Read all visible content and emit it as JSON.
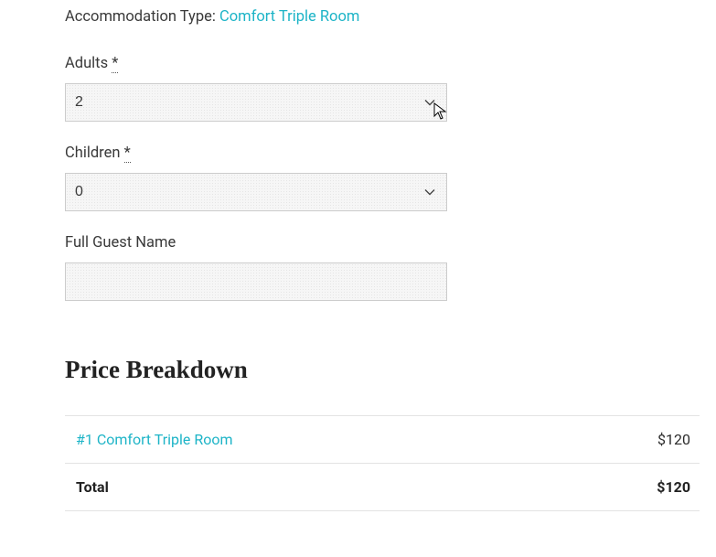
{
  "accommodation": {
    "label": "Accommodation Type:",
    "name": "Comfort Triple Room"
  },
  "fields": {
    "adults": {
      "label": "Adults",
      "required_marker": "*",
      "value": "2"
    },
    "children": {
      "label": "Children",
      "required_marker": "*",
      "value": "0"
    },
    "full_guest_name": {
      "label": "Full Guest Name",
      "value": ""
    }
  },
  "price": {
    "heading": "Price Breakdown",
    "item": {
      "label": "#1 Comfort Triple Room",
      "amount": "$120"
    },
    "total": {
      "label": "Total",
      "amount": "$120"
    }
  }
}
